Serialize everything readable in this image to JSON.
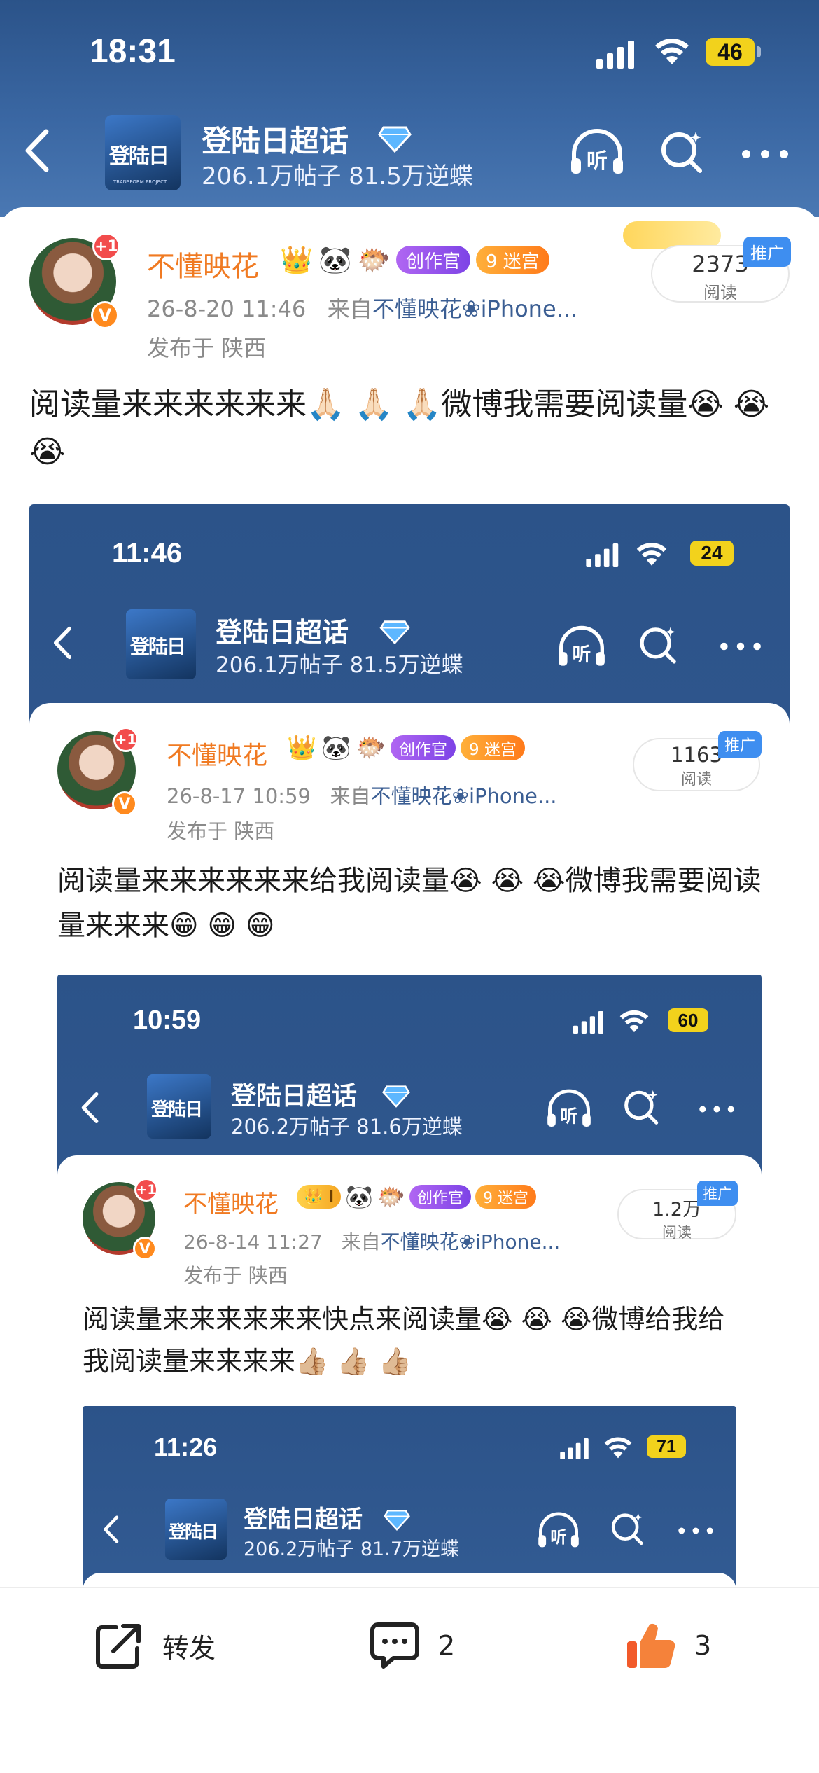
{
  "status_bar": {
    "time": "18:31",
    "battery": "46"
  },
  "topic": {
    "logo_text": "登陆日",
    "logo_sub": "TRANSFORM PROJECT",
    "title": "登陆日超话",
    "stats": "206.1万帖子 81.5万逆蝶"
  },
  "post": {
    "avatar_badge": "+1",
    "verified_mark": "V",
    "username": "不懂映花",
    "badges": {
      "emoji1": "👑",
      "emoji2": "🐼",
      "emoji3": "🐡",
      "creator": "创作官",
      "maze": "9 迷宫"
    },
    "time": "26-8-20 11:46",
    "source_prefix": "来自",
    "source": "不懂映花❀iPhone...",
    "location": "发布于 陕西",
    "read_count": "2373",
    "read_label": "阅读",
    "promo_label": "推广",
    "text": "阅读量来来来来来来🙏🏻 🙏🏻 🙏🏻微博我需要阅读量😭 😭 😭"
  },
  "nested1": {
    "time": "11:46",
    "battery": "24",
    "title": "登陆日超话",
    "stats": "206.1万帖子 81.5万逆蝶",
    "avatar_badge": "+1",
    "username": "不懂映花",
    "badges": {
      "emoji1": "👑",
      "emoji2": "🐼",
      "emoji3": "🐡",
      "creator": "创作官",
      "maze": "9 迷宫"
    },
    "time_meta": "26-8-17 10:59",
    "source_prefix": "来自",
    "source": "不懂映花❀iPhone...",
    "location": "发布于 陕西",
    "read_count": "1163",
    "read_label": "阅读",
    "promo_label": "推广",
    "text": "阅读量来来来来来来给我阅读量😭 😭 😭微博我需要阅读量来来来😁 😁 😁"
  },
  "nested2": {
    "time": "10:59",
    "battery": "60",
    "title": "登陆日超话",
    "stats": "206.2万帖子 81.6万逆蝶",
    "avatar_badge": "+1",
    "username": "不懂映花",
    "badges": {
      "crown": "👑 I",
      "emoji2": "🐼",
      "emoji3": "🐡",
      "creator": "创作官",
      "maze": "9 迷宫"
    },
    "time_meta": "26-8-14 11:27",
    "source_prefix": "来自",
    "source": "不懂映花❀iPhone...",
    "location": "发布于 陕西",
    "read_count": "1.2万",
    "read_label": "阅读",
    "promo_label": "推广",
    "text": "阅读量来来来来来来快点来阅读量😭 😭 😭微博给我给我阅读量来来来来👍🏼 👍🏼 👍🏼"
  },
  "nested3": {
    "time": "11:26",
    "battery": "71",
    "title": "登陆日超话",
    "stats": "206.2万帖子 81.7万逆蝶"
  },
  "actions": {
    "share_label": "转发",
    "comment_count": "2",
    "like_count": "3"
  },
  "colors": {
    "header_blue": "#2b5389",
    "username_orange": "#f07a22",
    "like_orange": "#f25a2a",
    "promo_blue": "#3e8ef0"
  }
}
